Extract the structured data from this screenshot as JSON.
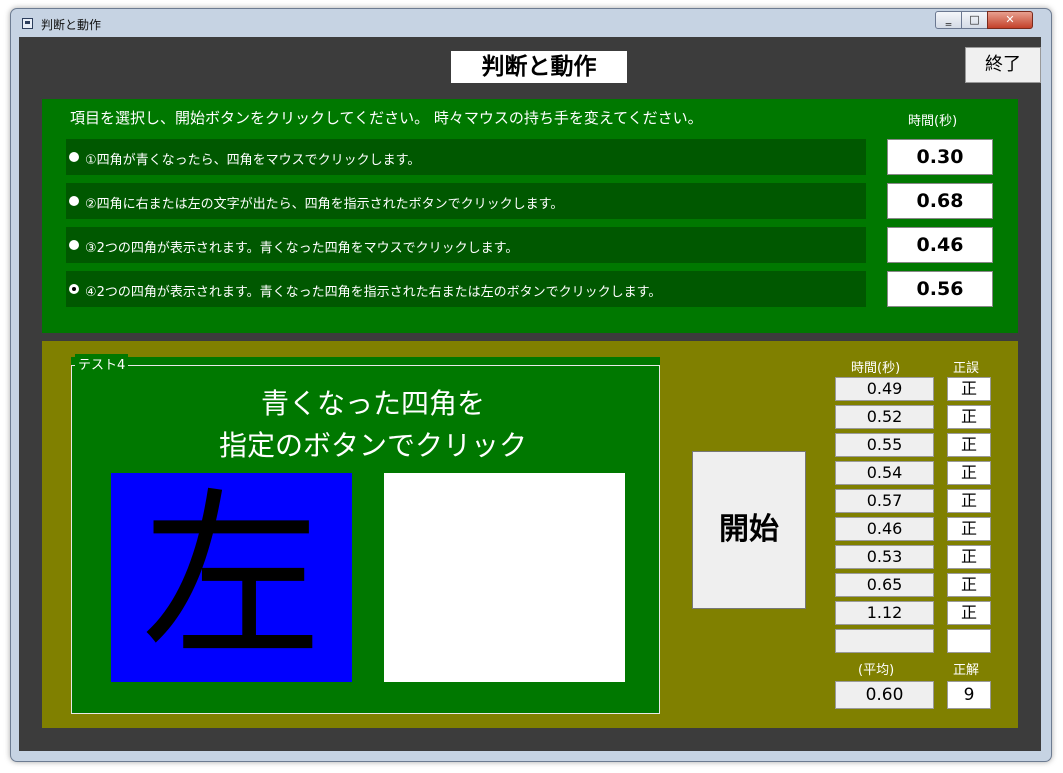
{
  "window": {
    "title": "判断と動作",
    "minimize": "‗",
    "maximize": "□",
    "close": "✕"
  },
  "header": {
    "app_title": "判断と動作",
    "quit_label": "終了"
  },
  "selection": {
    "instruction": "項目を選択し、開始ボタンをクリックしてください。 時々マウスの持ち手を変えてください。",
    "time_header": "時間(秒)",
    "options": [
      {
        "label": "①四角が青くなったら、四角をマウスでクリックします。",
        "time": "0.30",
        "selected": false
      },
      {
        "label": "②四角に右または左の文字が出たら、四角を指示されたボタンでクリックします。",
        "time": "0.68",
        "selected": false
      },
      {
        "label": "③2つの四角が表示されます。青くなった四角をマウスでクリックします。",
        "time": "0.46",
        "selected": false
      },
      {
        "label": "④2つの四角が表示されます。青くなった四角を指示された右または左のボタンでクリックします。",
        "time": "0.56",
        "selected": true
      }
    ]
  },
  "test": {
    "legend": "テスト4",
    "prompt_line1": "青くなった四角を",
    "prompt_line2": "指定のボタンでクリック",
    "left_square_char": "左",
    "left_square_color": "#0000ff",
    "right_square_color": "#ffffff",
    "start_label": "開始"
  },
  "results": {
    "time_header": "時間(秒)",
    "correct_header": "正誤",
    "rows": [
      {
        "time": "0.49",
        "mark": "正"
      },
      {
        "time": "0.52",
        "mark": "正"
      },
      {
        "time": "0.55",
        "mark": "正"
      },
      {
        "time": "0.54",
        "mark": "正"
      },
      {
        "time": "0.57",
        "mark": "正"
      },
      {
        "time": "0.46",
        "mark": "正"
      },
      {
        "time": "0.53",
        "mark": "正"
      },
      {
        "time": "0.65",
        "mark": "正"
      },
      {
        "time": "1.12",
        "mark": "正"
      },
      {
        "time": "",
        "mark": ""
      }
    ],
    "average_label": "(平均)",
    "correct_label": "正解",
    "average_value": "0.60",
    "correct_count": "9"
  },
  "colors": {
    "panel_green": "#007800",
    "option_green": "#005800",
    "panel_olive": "#808000",
    "client_gray": "#3c3c3c"
  }
}
